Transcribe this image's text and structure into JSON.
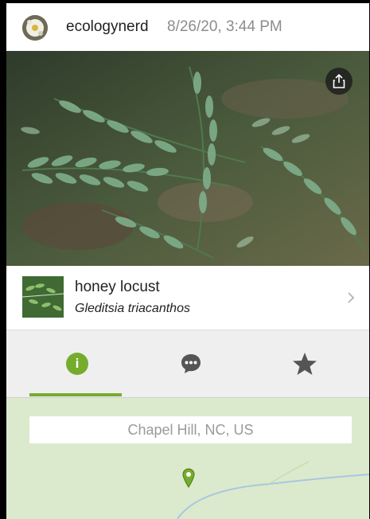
{
  "header": {
    "username": "ecologynerd",
    "timestamp": "8/26/20, 3:44 PM"
  },
  "photo": {
    "share_icon": "share-icon"
  },
  "taxon": {
    "common_name": "honey locust",
    "scientific_name": "Gleditsia triacanthos",
    "chevron_icon": "chevron-right-icon"
  },
  "tabs": [
    {
      "name": "info",
      "icon": "info-icon",
      "selected": true
    },
    {
      "name": "comments",
      "icon": "comment-bubble-icon",
      "selected": false
    },
    {
      "name": "favorites",
      "icon": "star-icon",
      "selected": false
    }
  ],
  "map": {
    "location": "Chapel Hill, NC, US",
    "pin_icon": "map-pin-icon"
  },
  "colors": {
    "accent": "#76ac2c",
    "map_background": "#dbeacc",
    "tab_background": "#efefef"
  }
}
